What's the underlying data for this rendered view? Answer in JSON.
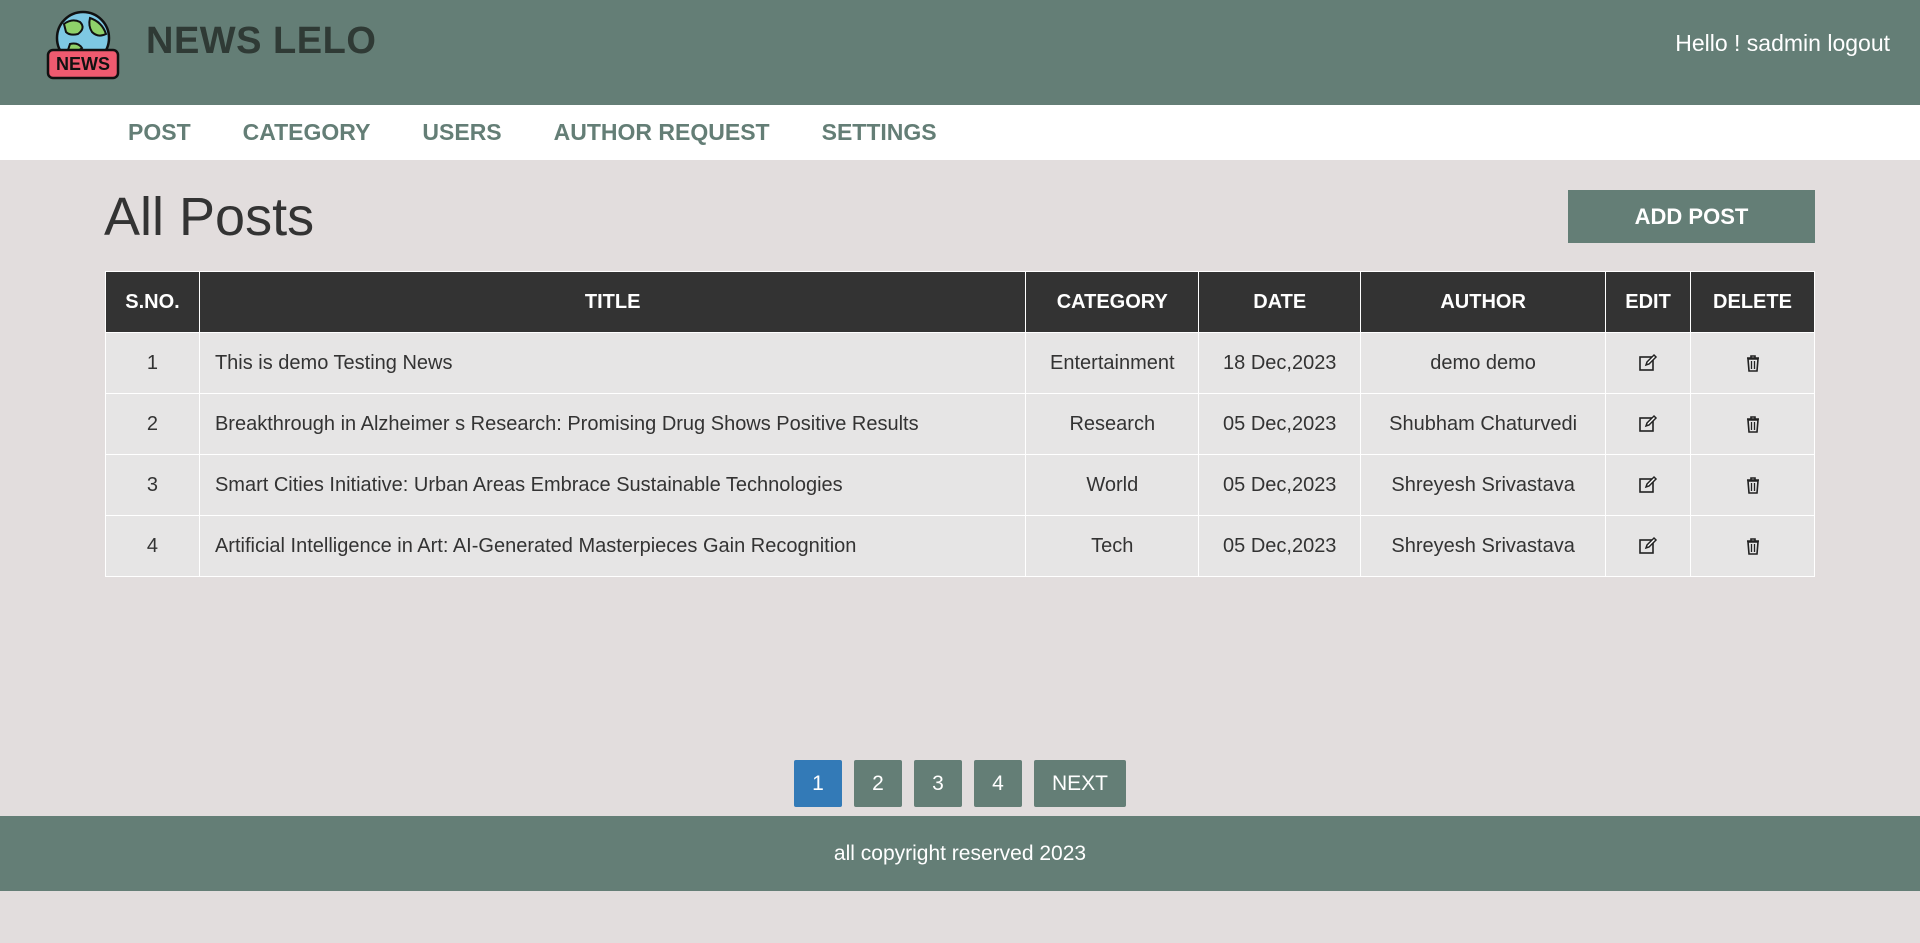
{
  "header": {
    "brand": "NEWS LELO",
    "logo_text": "NEWS",
    "greeting": "Hello ! sadmin",
    "logout_label": "logout"
  },
  "nav": {
    "items": [
      {
        "label": "POST"
      },
      {
        "label": "CATEGORY"
      },
      {
        "label": "USERS"
      },
      {
        "label": "AUTHOR REQUEST"
      },
      {
        "label": "SETTINGS"
      }
    ]
  },
  "main": {
    "title": "All Posts",
    "add_button": "ADD POST"
  },
  "table": {
    "headers": [
      "S.NO.",
      "TITLE",
      "CATEGORY",
      "DATE",
      "AUTHOR",
      "EDIT",
      "DELETE"
    ],
    "rows": [
      {
        "sno": "1",
        "title": "This is demo Testing News",
        "category": "Entertainment",
        "date": "18 Dec,2023",
        "author": "demo demo"
      },
      {
        "sno": "2",
        "title": "Breakthrough in Alzheimer s Research: Promising Drug Shows Positive Results",
        "category": "Research",
        "date": "05 Dec,2023",
        "author": "Shubham Chaturvedi"
      },
      {
        "sno": "3",
        "title": "Smart Cities Initiative: Urban Areas Embrace Sustainable Technologies",
        "category": "World",
        "date": "05 Dec,2023",
        "author": "Shreyesh Srivastava"
      },
      {
        "sno": "4",
        "title": "Artificial Intelligence in Art: AI-Generated Masterpieces Gain Recognition",
        "category": "Tech",
        "date": "05 Dec,2023",
        "author": "Shreyesh Srivastava"
      }
    ],
    "edit_icon": "edit-icon",
    "delete_icon": "trash-icon"
  },
  "pagination": {
    "pages": [
      "1",
      "2",
      "3",
      "4"
    ],
    "active": "1",
    "next_label": "NEXT"
  },
  "footer": {
    "text": "all copyright reserved 2023"
  },
  "colors": {
    "header_bg": "#647e76",
    "page_bg": "#e2dddd",
    "table_header_bg": "#333333",
    "active_page": "#337ab7"
  }
}
